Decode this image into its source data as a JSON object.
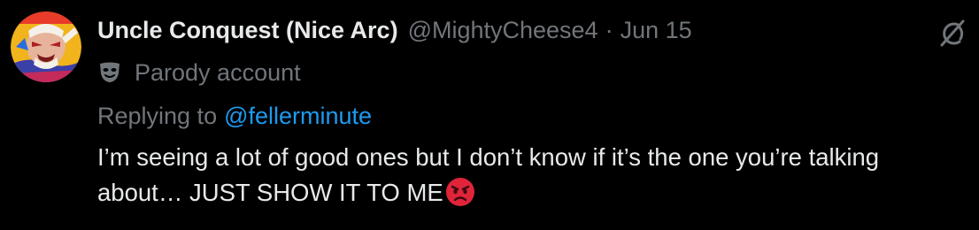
{
  "author": {
    "display_name": "Uncle Conquest (Nice Arc)",
    "handle": "@MightyCheese4",
    "separator": "·",
    "date": "Jun 15",
    "label": "Parody account",
    "avatar_icon": "cartoon-character-avatar"
  },
  "reply": {
    "prefix": "Replying to",
    "mention": "@fellerminute"
  },
  "tweet": {
    "text_line1": "I’m seeing a lot of good ones but I don’t know if it’s the one you’re talking",
    "text_line2": "about… JUST SHOW IT TO ME",
    "emoji": "angry-face-emoji"
  },
  "icons": {
    "grok": "grok-icon",
    "parody_mask": "theater-mask-icon"
  },
  "colors": {
    "background": "#000000",
    "primary_text": "#e7e9ea",
    "secondary_text": "#71767b",
    "link": "#1d9bf0"
  }
}
